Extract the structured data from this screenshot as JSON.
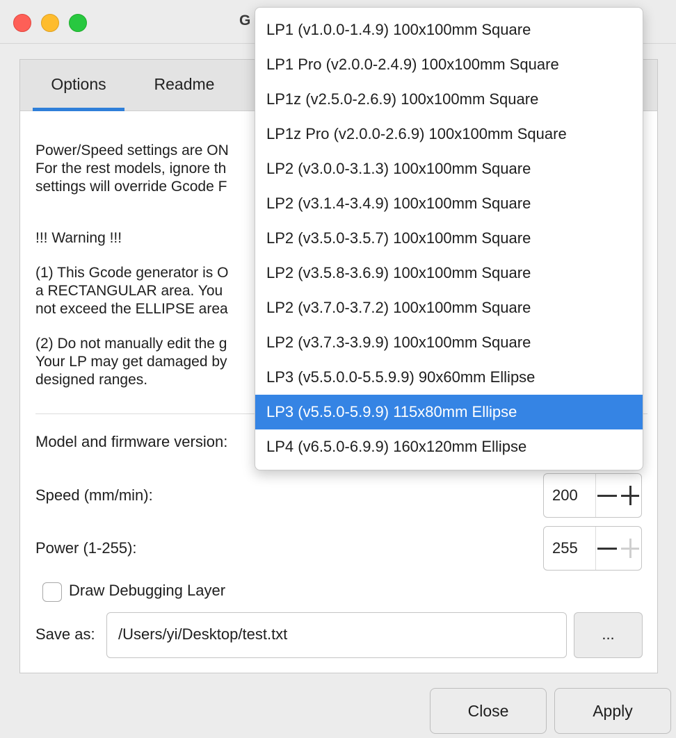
{
  "window": {
    "title": "G"
  },
  "tabs": [
    {
      "label": "Options"
    },
    {
      "label": "Readme"
    }
  ],
  "description": {
    "line1": "Power/Speed settings are ON",
    "line2": "For the rest models, ignore th",
    "line3": "settings will override Gcode F",
    "warning_title": "!!! Warning !!!",
    "w1_line1": "(1) This Gcode generator is O",
    "w1_line2": "a RECTANGULAR area. You",
    "w1_line3": "not exceed the ELLIPSE area",
    "w2_line1": "(2) Do not manually edit the g",
    "w2_line2": "Your LP may get damaged by",
    "w2_line3": "designed ranges."
  },
  "model": {
    "label": "Model and firmware version:"
  },
  "speed": {
    "label": "Speed (mm/min):",
    "value": "200"
  },
  "power": {
    "label": "Power (1-255):",
    "value": "255"
  },
  "debug": {
    "label": "Draw Debugging Layer",
    "checked": false
  },
  "save": {
    "label": "Save as:",
    "path": "/Users/yi/Desktop/test.txt",
    "browse_label": "..."
  },
  "buttons": {
    "close": "Close",
    "apply": "Apply"
  },
  "dropdown": {
    "items": [
      "LP1 (v1.0.0-1.4.9) 100x100mm Square",
      "LP1 Pro (v2.0.0-2.4.9) 100x100mm Square",
      "LP1z (v2.5.0-2.6.9) 100x100mm Square",
      "LP1z Pro (v2.0.0-2.6.9) 100x100mm Square",
      "LP2 (v3.0.0-3.1.3) 100x100mm Square",
      "LP2 (v3.1.4-3.4.9) 100x100mm Square",
      "LP2 (v3.5.0-3.5.7) 100x100mm Square",
      "LP2 (v3.5.8-3.6.9) 100x100mm Square",
      "LP2 (v3.7.0-3.7.2) 100x100mm Square",
      "LP2 (v3.7.3-3.9.9) 100x100mm Square",
      "LP3 (v5.5.0.0-5.5.9.9) 90x60mm Ellipse",
      "LP3 (v5.5.0-5.9.9) 115x80mm Ellipse",
      "LP4 (v6.5.0-6.9.9) 160x120mm Ellipse"
    ],
    "selected": "LP3 (v5.5.0-5.9.9) 115x80mm Ellipse"
  },
  "colors": {
    "accent": "#3584e4",
    "tab_underline": "#2f7fd9"
  }
}
